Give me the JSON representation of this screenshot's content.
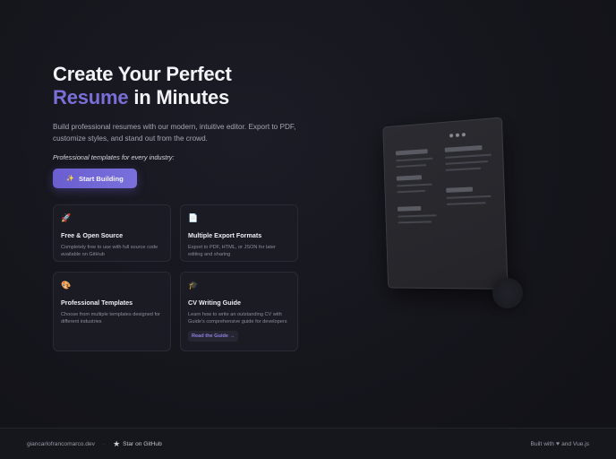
{
  "hero": {
    "title_line1": "Create Your Perfect",
    "title_accent": "Resume",
    "title_rest": " in Minutes",
    "description": "Build professional resumes with our modern, intuitive editor. Export to PDF, customize styles, and stand out from the crowd.",
    "tagline": "Professional templates for every industry:",
    "cta_label": "Start Building",
    "cta_icon": "sparkle-icon"
  },
  "features": [
    {
      "icon": "rocket-icon",
      "title": "Free & Open Source",
      "text": "Completely free to use with full source code available on GitHub"
    },
    {
      "icon": "document-icon",
      "title": "Multiple Export Formats",
      "text": "Export to PDF, HTML, or JSON for later editing and sharing"
    },
    {
      "icon": "palette-icon",
      "title": "Professional Templates",
      "text": "Choose from multiple templates designed for different industries"
    },
    {
      "icon": "graduation-cap-icon",
      "title": "CV Writing Guide",
      "text": "Learn how to write an outstanding CV with Guide's comprehensive guide for developers",
      "button": "Read the Guide →"
    }
  ],
  "footer": {
    "site": "giancarlofrancomarco.dev",
    "separator": "·",
    "github_label": "Star on GitHub",
    "built_prefix": "Built with",
    "heart": "♥",
    "built_suffix": "and Vue.js"
  },
  "colors": {
    "accent": "#7a6fd6",
    "background": "#15151c",
    "card": "#1b1b23"
  }
}
